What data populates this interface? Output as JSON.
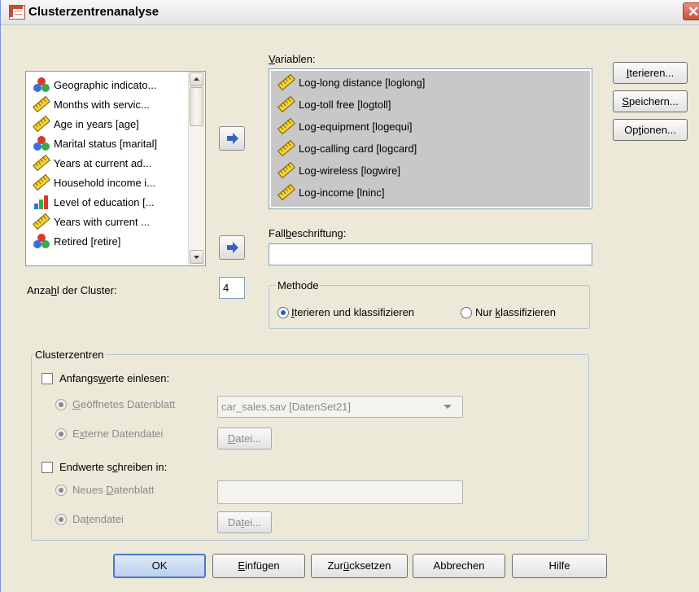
{
  "window": {
    "title": "Clusterzentrenanalyse",
    "close_glyph": "✕"
  },
  "source_list": {
    "items": [
      {
        "label": "Geographic indicato...",
        "icon": "nominal-icon"
      },
      {
        "label": "Months with servic...",
        "icon": "scale-icon"
      },
      {
        "label": "Age in years [age]",
        "icon": "scale-icon"
      },
      {
        "label": "Marital status [marital]",
        "icon": "nominal-icon"
      },
      {
        "label": "Years at current ad...",
        "icon": "scale-icon"
      },
      {
        "label": "Household income i...",
        "icon": "scale-icon"
      },
      {
        "label": "Level of education [...",
        "icon": "ordinal-icon"
      },
      {
        "label": "Years with current ...",
        "icon": "scale-icon"
      },
      {
        "label": "Retired [retire]",
        "icon": "nominal-icon"
      }
    ]
  },
  "variables": {
    "label_pre": "",
    "label_mnemonic": "V",
    "label_post": "ariablen:",
    "items": [
      "Log-long distance [loglong]",
      "Log-toll free [logtoll]",
      "Log-equipment [logequi]",
      "Log-calling card [logcard]",
      "Log-wireless [logwire]",
      "Log-income [lninc]"
    ]
  },
  "case_label": {
    "label_pre": "Fall",
    "label_mnemonic": "b",
    "label_post": "eschriftung:",
    "value": ""
  },
  "clusters": {
    "label_pre": "Anza",
    "label_mnemonic": "h",
    "label_post": "l der Cluster:",
    "value": "4"
  },
  "method": {
    "legend": "Methode",
    "option1_mnemonic": "I",
    "option1_post": "terieren und klassifizieren",
    "option2_pre": "Nur ",
    "option2_mnemonic": "k",
    "option2_post": "lassifizieren",
    "selected": "iterate"
  },
  "cluster_centers": {
    "legend": "Clusterzentren",
    "read_initial": {
      "pre": "Anfangs",
      "mnemonic": "w",
      "post": "erte einlesen:",
      "checked": false
    },
    "open_dataset": {
      "mnemonic": "G",
      "post": "eöffnetes Datenblatt",
      "value": "car_sales.sav [DatenSet21]"
    },
    "external_file_in": {
      "pre": "E",
      "mnemonic": "x",
      "post": "terne Datendatei",
      "button_mnemonic": "D",
      "button_post": "atei..."
    },
    "write_final": {
      "pre": "Endwerte s",
      "mnemonic": "c",
      "post": "hreiben in:",
      "checked": false
    },
    "new_dataset": {
      "pre": "Neues ",
      "mnemonic": "D",
      "post": "atenblatt",
      "value": ""
    },
    "data_file_out": {
      "pre": "Da",
      "mnemonic": "t",
      "post": "endatei",
      "button_pre": "Da",
      "button_mnemonic": "t",
      "button_post": "ei..."
    }
  },
  "side_buttons": [
    {
      "mnemonic": "I",
      "post": "terieren..."
    },
    {
      "mnemonic": "S",
      "post": "peichern..."
    },
    {
      "pre": "Op",
      "mnemonic": "t",
      "post": "ionen..."
    }
  ],
  "bottom_buttons": {
    "ok": "OK",
    "paste": {
      "mnemonic": "E",
      "post": "infügen"
    },
    "reset": {
      "pre": "Zur",
      "mnemonic": "ü",
      "post": "cksetzen"
    },
    "cancel": "Abbrechen",
    "help": "Hilfe"
  },
  "colors": {
    "dialog_bg": "#ece9d8",
    "selection_bg": "#c8c8c8",
    "accent": "#4a79c6",
    "arrow_fill": "#3a5fc4"
  }
}
